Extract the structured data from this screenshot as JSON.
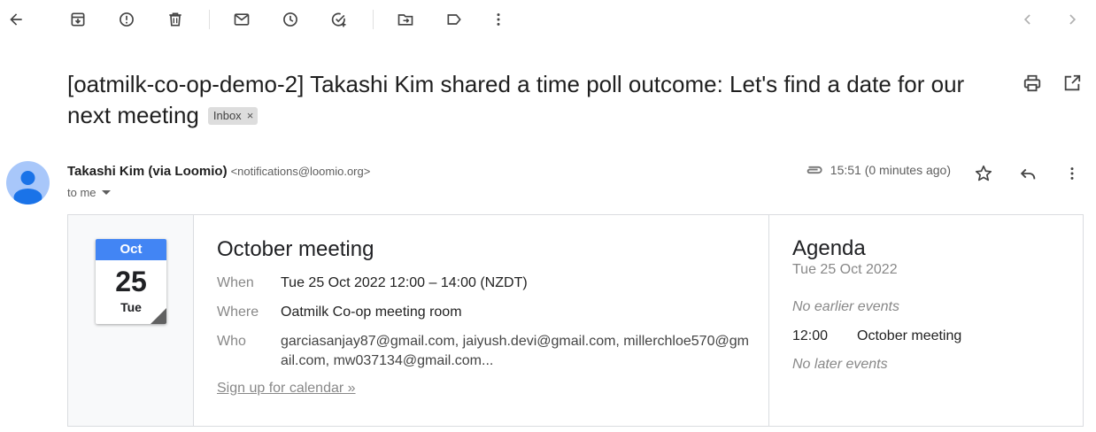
{
  "toolbar": {
    "icons": [
      "back-arrow-icon",
      "archive-icon",
      "report-spam-icon",
      "delete-icon",
      "mark-unread-icon",
      "snooze-icon",
      "add-to-tasks-icon",
      "move-to-icon",
      "label-icon",
      "more-vert-icon",
      "newer-chevron-icon",
      "older-chevron-icon"
    ]
  },
  "subject": {
    "text": "[oatmilk-co-op-demo-2] Takashi Kim shared a time poll outcome: Let's find a date for our next meeting",
    "label_chip": "Inbox",
    "label_remove": "×"
  },
  "message": {
    "sender_name": "Takashi Kim (via Loomio)",
    "sender_email": "<notifications@loomio.org>",
    "recipient": "to me",
    "time": "15:51 (0 minutes ago)"
  },
  "invite": {
    "calendar_month": "Oct",
    "calendar_day": "25",
    "calendar_weekday": "Tue",
    "event_title": "October meeting",
    "when_label": "When",
    "when_value": "Tue 25 Oct 2022 12:00 – 14:00 (NZDT)",
    "where_label": "Where",
    "where_value": "Oatmilk Co-op meeting room",
    "who_label": "Who",
    "who_value": "garciasanjay87@gmail.com, jaiyush.devi@gmail.com, millerchloe570@gmail.com, mw037134@gmail.com...",
    "signup_link": "Sign up for calendar »"
  },
  "agenda": {
    "title": "Agenda",
    "date": "Tue 25 Oct 2022",
    "no_earlier": "No earlier events",
    "event_time": "12:00",
    "event_name": "October meeting",
    "no_later": "No later events"
  },
  "colors": {
    "calendar_header": "#4285f4",
    "avatar_bg": "#a8c7fa",
    "avatar_fg": "#1a73e8",
    "chip_bg": "#dddddd"
  }
}
